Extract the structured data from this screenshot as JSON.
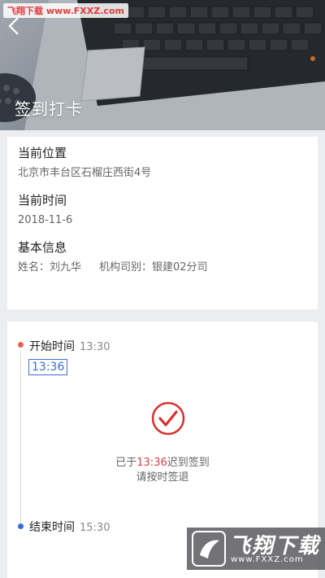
{
  "watermark": "飞翔下载 www.FXXZ.com",
  "header": {
    "back_icon": "chevron-left-icon",
    "title": "签到打卡"
  },
  "info": {
    "location_label": "当前位置",
    "location_value": "北京市丰台区石榴庄西街4号",
    "time_label": "当前时间",
    "time_value": "2018-11-6",
    "basic_label": "基本信息",
    "name_field": "姓名：刘九华",
    "org_field": "机构司别：银建02分司"
  },
  "timeline": {
    "start_label": "开始时间",
    "start_time": "13:30",
    "checkin_time": "13:36",
    "status_prefix": "已于",
    "status_time": "13:36",
    "status_suffix": "迟到签到",
    "status_line2": "请按时签退",
    "end_label": "结束时间",
    "end_time": "15:30",
    "check_icon": "check-circle-icon"
  },
  "colors": {
    "accent_red": "#e23b3b",
    "start_dot": "#e8624f",
    "end_dot": "#2f6fd6",
    "time_box": "#3a6fd0"
  },
  "bottom_logo": {
    "text": "飞翔下载",
    "url": "www.FXXZ.com"
  }
}
